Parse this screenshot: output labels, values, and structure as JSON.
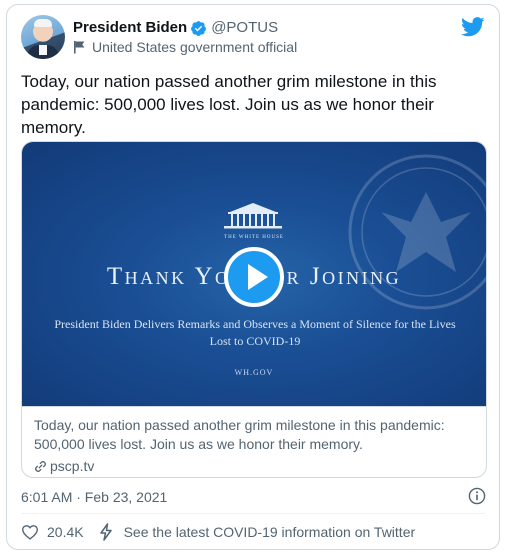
{
  "author": {
    "display_name": "President Biden",
    "handle": "@POTUS",
    "label": "United States government official"
  },
  "tweet": {
    "text": "Today, our nation passed another grim milestone in this pandemic: 500,000 lives lost. Join us as we honor their memory.",
    "timestamp": "6:01 AM · Feb 23, 2021",
    "likes": "20.4K",
    "covid_link": "See the latest COVID-19 information on Twitter"
  },
  "media": {
    "wh_caption": "THE WHITE HOUSE",
    "title": "Thank You For Joining",
    "subtitle": "President Biden Delivers Remarks and Observes a Moment of Silence for the Lives Lost to COVID-19",
    "domain_on_image": "WH.GOV",
    "card_description": "Today, our nation passed another grim milestone in this pandemic: 500,000 lives lost. Join us as we honor their memory.",
    "card_link": "pscp.tv"
  },
  "colors": {
    "accent": "#1d9bf0",
    "text_secondary": "#536471",
    "media_background": "#1a4e94"
  },
  "icons": [
    "verified-badge-icon",
    "flag-icon",
    "twitter-bird-icon",
    "play-icon",
    "link-icon",
    "info-icon",
    "heart-icon",
    "bolt-icon"
  ]
}
